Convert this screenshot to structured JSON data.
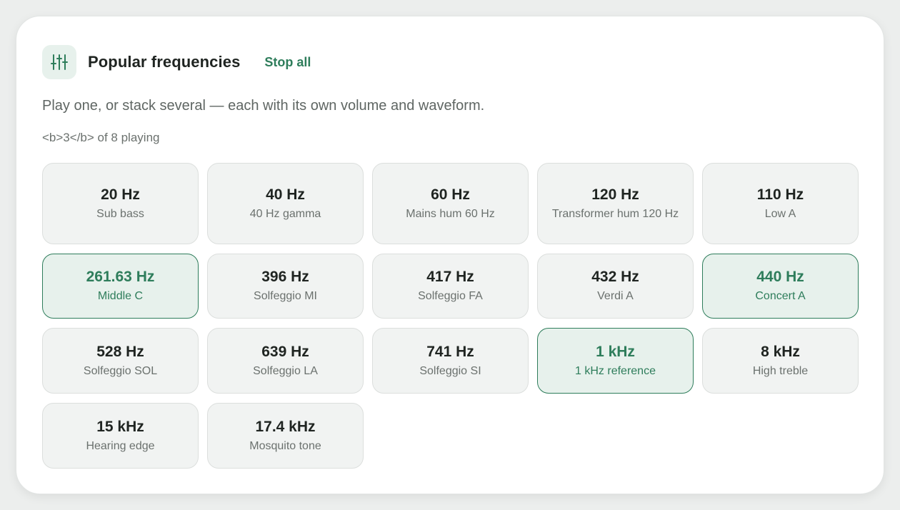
{
  "header": {
    "icon": "sliders-icon",
    "title": "Popular frequencies",
    "stop_all_label": "Stop all"
  },
  "subtitle": "Play one, or stack several — each with its own volume and waveform.",
  "count_text": "<b>3</b> of 8 playing",
  "colors": {
    "accent": "#2e7d5b",
    "active_bg": "#e7f1ec",
    "tile_bg": "#f1f3f2"
  },
  "presets": [
    {
      "freq": "20 Hz",
      "label": "Sub bass",
      "active": false
    },
    {
      "freq": "40 Hz",
      "label": "40 Hz gamma",
      "active": false
    },
    {
      "freq": "60 Hz",
      "label": "Mains hum 60 Hz",
      "active": false
    },
    {
      "freq": "120 Hz",
      "label": "Transformer hum 120 Hz",
      "active": false
    },
    {
      "freq": "110 Hz",
      "label": "Low A",
      "active": false
    },
    {
      "freq": "261.63 Hz",
      "label": "Middle C",
      "active": true
    },
    {
      "freq": "396 Hz",
      "label": "Solfeggio MI",
      "active": false
    },
    {
      "freq": "417 Hz",
      "label": "Solfeggio FA",
      "active": false
    },
    {
      "freq": "432 Hz",
      "label": "Verdi A",
      "active": false
    },
    {
      "freq": "440 Hz",
      "label": "Concert A",
      "active": true
    },
    {
      "freq": "528 Hz",
      "label": "Solfeggio SOL",
      "active": false
    },
    {
      "freq": "639 Hz",
      "label": "Solfeggio LA",
      "active": false
    },
    {
      "freq": "741 Hz",
      "label": "Solfeggio SI",
      "active": false
    },
    {
      "freq": "1 kHz",
      "label": "1 kHz reference",
      "active": true
    },
    {
      "freq": "8 kHz",
      "label": "High treble",
      "active": false
    },
    {
      "freq": "15 kHz",
      "label": "Hearing edge",
      "active": false
    },
    {
      "freq": "17.4 kHz",
      "label": "Mosquito tone",
      "active": false
    }
  ]
}
